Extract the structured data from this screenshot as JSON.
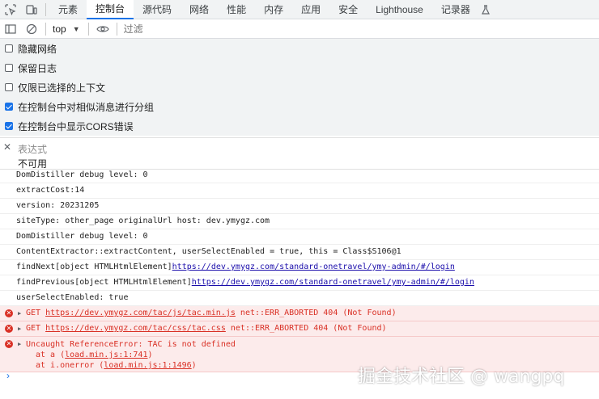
{
  "tabs": [
    "元素",
    "控制台",
    "源代码",
    "网络",
    "性能",
    "内存",
    "应用",
    "安全",
    "Lighthouse",
    "记录器"
  ],
  "active_tab_index": 1,
  "toolbar": {
    "context": "top",
    "filter_placeholder": "过滤"
  },
  "settings": [
    {
      "label": "隐藏网络",
      "checked": false
    },
    {
      "label": "保留日志",
      "checked": false
    },
    {
      "label": "仅限已选择的上下文",
      "checked": false
    },
    {
      "label": "在控制台中对相似消息进行分组",
      "checked": true
    },
    {
      "label": "在控制台中显示CORS错误",
      "checked": true
    }
  ],
  "live_expression": {
    "name": "表达式",
    "value": "不可用"
  },
  "console_lines": [
    {
      "text": "DomDistiller debug level: 0"
    },
    {
      "text": "extractCost:14"
    },
    {
      "text": "version: 20231205"
    },
    {
      "text": "siteType: other_page originalUrl host: dev.ymygz.com"
    },
    {
      "text": "DomDistiller debug level: 0"
    },
    {
      "text": "ContentExtractor::extractContent, userSelectEnabled = true, this = Class$S106@1"
    },
    {
      "text": "findNext[object HTMLHtmlElement]",
      "link": "https://dev.ymygz.com/standard-onetravel/ymy-admin/#/login"
    },
    {
      "text": "findPrevious[object HTMLHtmlElement]",
      "link": "https://dev.ymygz.com/standard-onetravel/ymy-admin/#/login"
    },
    {
      "text": "userSelectEnabled: true"
    }
  ],
  "errors": [
    {
      "prefix": "GET ",
      "link": "https://dev.ymygz.com/tac/js/tac.min.js",
      "suffix": " net::ERR_ABORTED 404 (Not Found)"
    },
    {
      "prefix": "GET ",
      "link": "https://dev.ymygz.com/tac/css/tac.css",
      "suffix": " net::ERR_ABORTED 404 (Not Found)"
    }
  ],
  "exception": {
    "message": "Uncaught ReferenceError: TAC is not defined",
    "frames": [
      {
        "at": "at a (",
        "link": "load.min.js:1:741",
        "close": ")"
      },
      {
        "at": "at i.onerror (",
        "link": "load.min.js:1:1496",
        "close": ")"
      }
    ]
  },
  "prompt_symbol": "›",
  "watermark": "掘金技术社区 @ wangpq",
  "colors": {
    "accent": "#1a73e8",
    "error": "#d93025",
    "error_bg": "#fcebeb"
  }
}
